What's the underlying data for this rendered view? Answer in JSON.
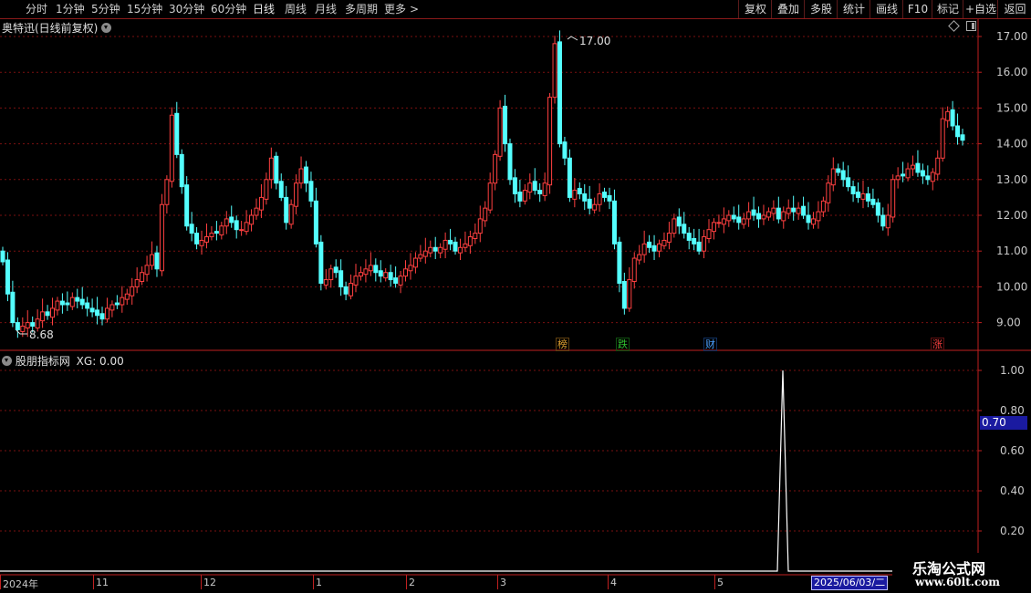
{
  "toolbar": {
    "periods": [
      "分时",
      "1分钟",
      "5分钟",
      "15分钟",
      "30分钟",
      "60分钟",
      "日线",
      "周线",
      "月线",
      "多周期",
      "更多"
    ],
    "active_period": "日线",
    "more_arrow": ">",
    "right_buttons": [
      "复权",
      "叠加",
      "多股",
      "统计",
      "画线",
      "F10",
      "标记",
      "+自选",
      "返回"
    ]
  },
  "main_panel": {
    "title": "奥特迅(日线前复权)",
    "y_ticks": [
      "17.00",
      "16.00",
      "15.00",
      "14.00",
      "13.00",
      "12.00",
      "11.00",
      "10.00",
      "9.00"
    ],
    "high_label": "17.00",
    "low_label": "8.68",
    "markers": [
      {
        "text": "榜",
        "color": "#e0a030"
      },
      {
        "text": "跌",
        "color": "#30c030"
      },
      {
        "text": "财",
        "color": "#4aa0ff"
      },
      {
        "text": "涨",
        "color": "#ff4040"
      }
    ],
    "icons": [
      "diamond-icon",
      "window-icon"
    ]
  },
  "indicator_panel": {
    "title": "股朋指标网",
    "xg_label": "XG: 0.00",
    "y_ticks": [
      "1.00",
      "0.80",
      "0.60",
      "0.40",
      "0.20"
    ],
    "current_value": "0.70"
  },
  "x_axis": {
    "labels": [
      "2024年",
      "11",
      "12",
      "1",
      "2",
      "3",
      "4",
      "5"
    ],
    "cursor_date": "2025/06/03/二"
  },
  "watermark": {
    "line1": "乐淘公式网",
    "line2": "www.60lt.com"
  },
  "colors": {
    "up": "#ff4040",
    "down": "#54ffff",
    "grid": "#7a1010",
    "axis": "#c02020",
    "signal": "#ffffff",
    "value_box": "#2020a0"
  },
  "chart_data": [
    {
      "type": "candlestick",
      "title": "奥特迅(日线前复权)",
      "ylim": [
        8.5,
        17.3
      ],
      "y_ticks": [
        9,
        10,
        11,
        12,
        13,
        14,
        15,
        16,
        17
      ],
      "x_labels": [
        "2024年",
        "11",
        "12",
        "1",
        "2",
        "3",
        "4",
        "5"
      ],
      "annotated_high": 17.0,
      "annotated_low": 8.68,
      "closes": [
        10.7,
        9.8,
        9.0,
        8.8,
        8.9,
        9.0,
        8.9,
        9.1,
        9.3,
        9.2,
        9.4,
        9.6,
        9.5,
        9.5,
        9.7,
        9.6,
        9.5,
        9.4,
        9.3,
        9.2,
        9.1,
        9.4,
        9.5,
        9.5,
        9.7,
        9.8,
        10.0,
        10.2,
        10.4,
        10.6,
        10.9,
        10.5,
        12.3,
        13.0,
        14.8,
        13.7,
        12.8,
        11.7,
        11.5,
        11.2,
        11.3,
        11.4,
        11.5,
        11.5,
        11.7,
        11.9,
        11.8,
        11.6,
        11.6,
        11.8,
        12.0,
        12.2,
        12.5,
        13.0,
        13.6,
        12.9,
        12.5,
        11.8,
        12.3,
        12.9,
        13.3,
        12.9,
        12.4,
        11.2,
        10.1,
        10.2,
        10.5,
        10.4,
        10.0,
        9.8,
        10.1,
        10.3,
        10.4,
        10.5,
        10.6,
        10.4,
        10.3,
        10.4,
        10.2,
        10.1,
        10.3,
        10.5,
        10.6,
        10.8,
        10.9,
        11.0,
        11.1,
        11.0,
        11.1,
        11.3,
        11.2,
        11.0,
        11.1,
        11.2,
        11.4,
        11.5,
        11.9,
        12.2,
        12.9,
        13.7,
        15.0,
        14.0,
        13.0,
        12.6,
        12.4,
        12.7,
        12.9,
        12.7,
        12.6,
        12.9,
        15.3,
        16.8,
        14.0,
        13.6,
        12.5,
        12.7,
        12.6,
        12.4,
        12.2,
        12.3,
        12.6,
        12.5,
        12.4,
        11.2,
        10.1,
        9.4,
        10.2,
        10.8,
        10.9,
        11.2,
        11.1,
        11.0,
        11.2,
        11.3,
        11.5,
        11.9,
        11.7,
        11.5,
        11.3,
        11.2,
        11.0,
        11.4,
        11.6,
        11.8,
        11.8,
        11.9,
        12.0,
        11.9,
        11.8,
        11.9,
        12.1,
        12.0,
        11.9,
        12.0,
        12.1,
        12.2,
        11.9,
        12.1,
        12.2,
        12.1,
        12.2,
        12.0,
        11.8,
        11.9,
        12.1,
        12.4,
        12.9,
        13.3,
        13.2,
        13.0,
        12.8,
        12.6,
        12.5,
        12.6,
        12.4,
        12.3,
        12.0,
        11.7,
        12.0,
        13.0,
        13.1,
        13.1,
        13.3,
        13.4,
        13.2,
        13.1,
        13.0,
        13.2,
        13.6,
        14.7,
        14.9,
        14.5,
        14.2,
        14.1
      ]
    },
    {
      "type": "line",
      "title": "股朋指标网",
      "series": [
        {
          "name": "XG",
          "values": "0 everywhere except a single spike to 1.00 shortly before 2025/06/03"
        }
      ],
      "ylim": [
        0,
        1.05
      ],
      "y_ticks": [
        0.2,
        0.4,
        0.6,
        0.8,
        1.0
      ],
      "spike_value": 1.0,
      "current_value": 0.7
    }
  ]
}
